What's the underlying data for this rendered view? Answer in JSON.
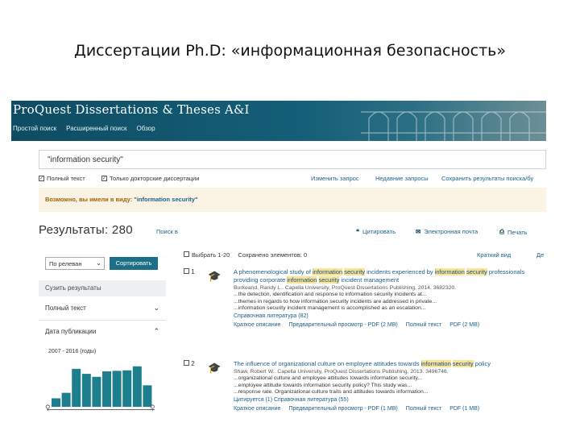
{
  "slide": {
    "title": "Диссертации Ph.D: «информационная безопасность»"
  },
  "header": {
    "title": "ProQuest Dissertations & Theses A&I",
    "nav": [
      "Простой поиск",
      "Расширенный поиск",
      "Обзор"
    ]
  },
  "search": {
    "query": "\"information security\""
  },
  "options": {
    "full_text": "Полный текст",
    "doctoral_only": "Только докторские диссертации",
    "modify": "Изменить запрос",
    "recent": "Недавние запросы",
    "save": "Сохранить результаты поиска/бу"
  },
  "suggestion": {
    "prefix": "Возможно, вы имели в виду:",
    "term": "\"information security\""
  },
  "results": {
    "heading": "Результаты: 280",
    "search_link": "Поиск в",
    "cite": "Цитировать",
    "email": "Электронная почта",
    "print": "Печать"
  },
  "sidebar": {
    "sort_value": "По релеван",
    "sort_button": "Сортировать",
    "refine": "Сузить результаты",
    "facet_full": "Полный текст",
    "facet_date": "Дата публикации",
    "date_range": "2007 - 2016 (годы)",
    "hist_values": [
      0.17,
      0.28,
      0.76,
      0.66,
      0.6,
      0.71,
      0.72,
      0.73,
      0.81,
      0.43
    ]
  },
  "list": {
    "select_label": "Выбрать 1-20",
    "save_label": "Сохранено элементов: 0",
    "brief": "Краткий вид",
    "detailed": "Де"
  },
  "records": [
    {
      "num": "1",
      "title_parts": [
        [
          "A phenomenological study of ",
          false
        ],
        [
          "information",
          true
        ],
        [
          " ",
          false
        ],
        [
          "security",
          true
        ],
        [
          " incidents experienced by ",
          false
        ],
        [
          "information",
          true
        ],
        [
          " ",
          false
        ],
        [
          "security",
          true
        ],
        [
          " professionals providing corporate ",
          false
        ],
        [
          "information",
          true
        ],
        [
          " ",
          false
        ],
        [
          "security",
          true
        ],
        [
          " incident management",
          false
        ]
      ],
      "meta": "Burkeand, Randy L.. Capella University, ProQuest Dissertations Publishing, 2014. 3682320.",
      "snippets": [
        "...the detection, identification and response to information security incidents at...",
        "...themes in regards to how information security incidents are addressed in private...",
        "...information security incident management is accomplished as an escalation..."
      ],
      "cited": "Справочная литература (82)",
      "links": [
        "Краткое описание",
        "Предварительный просмотр - PDF (2 MB)",
        "Полный текст",
        "PDF (2 MB)"
      ]
    },
    {
      "num": "2",
      "title_parts": [
        [
          "The influence of organizational culture on employee attitudes towards ",
          false
        ],
        [
          "information",
          true
        ],
        [
          " ",
          false
        ],
        [
          "security",
          true
        ],
        [
          " policy",
          false
        ]
      ],
      "meta": "Shaw, Robert W.. Capella University, ProQuest Dissertations Publishing, 2013. 3496746.",
      "snippets": [
        "...organizational culture and employee attitudes towards information security...",
        "...employee attitude towards information security policy? This study was...",
        "...response rate. Organizational culture traits and attitudes towards information..."
      ],
      "cited": "Цитируется (1)   Справочная литература (55)",
      "links": [
        "Краткое описание",
        "Предварительный просмотр - PDF (1 MB)",
        "Полный текст",
        "PDF (1 MB)"
      ]
    }
  ]
}
